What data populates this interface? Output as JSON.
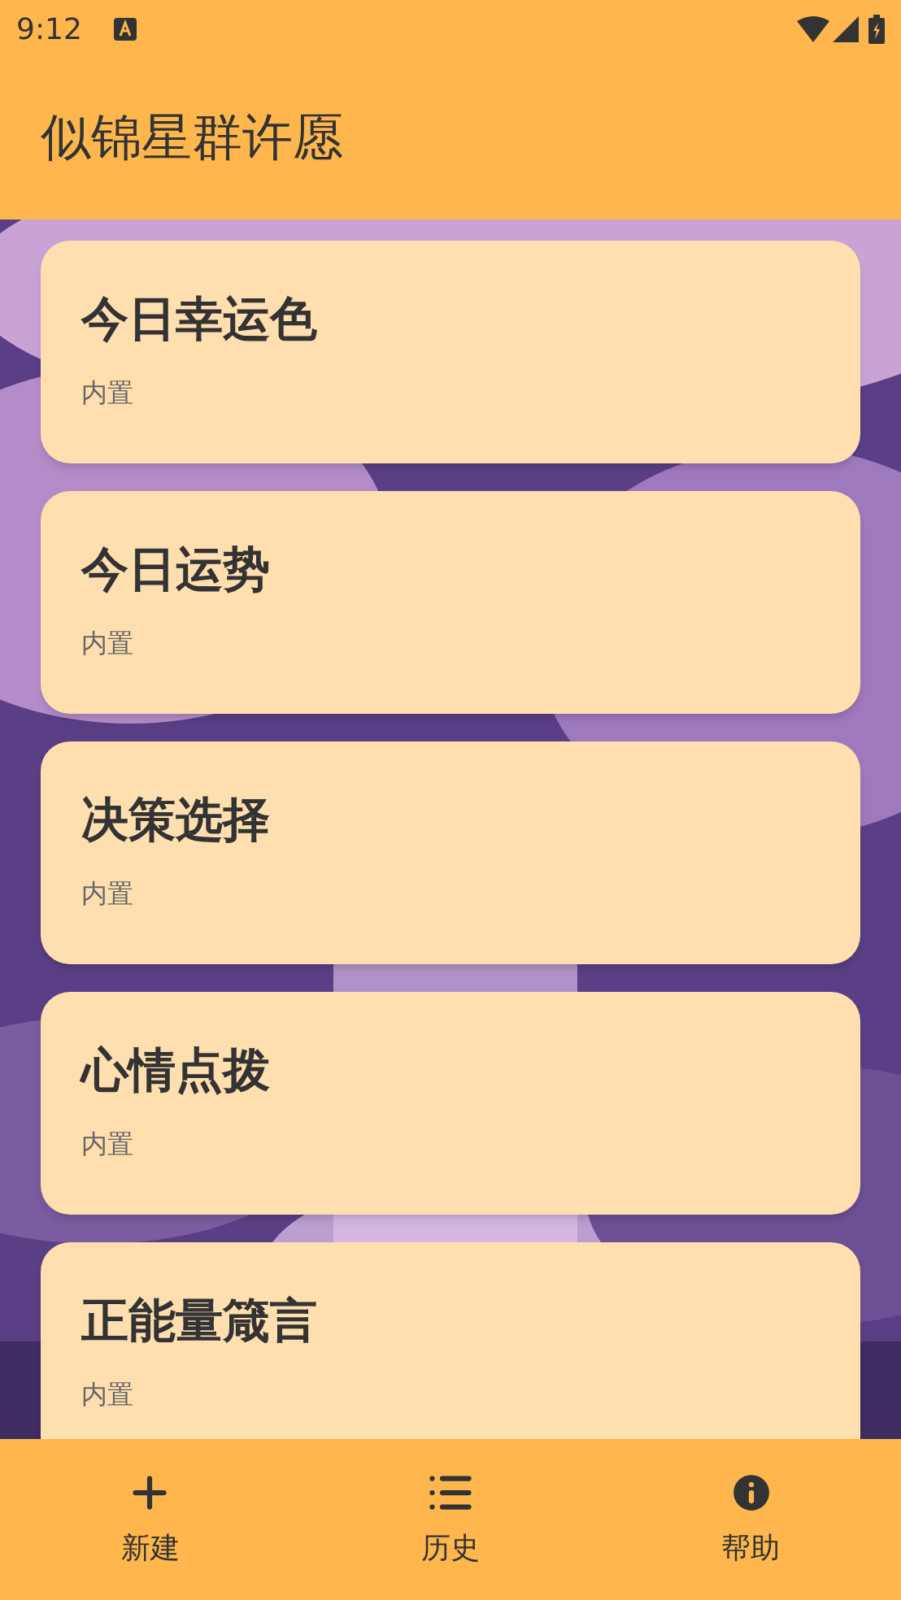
{
  "status_bar": {
    "time": "9:12"
  },
  "app_bar": {
    "title": "似锦星群许愿"
  },
  "cards": [
    {
      "title": "今日幸运色",
      "subtitle": "内置"
    },
    {
      "title": "今日运势",
      "subtitle": "内置"
    },
    {
      "title": "决策选择",
      "subtitle": "内置"
    },
    {
      "title": "心情点拨",
      "subtitle": "内置"
    },
    {
      "title": "正能量箴言",
      "subtitle": "内置"
    }
  ],
  "bottom_nav": [
    {
      "kind": "add",
      "label": "新建"
    },
    {
      "kind": "list",
      "label": "历史"
    },
    {
      "kind": "info",
      "label": "帮助"
    }
  ]
}
